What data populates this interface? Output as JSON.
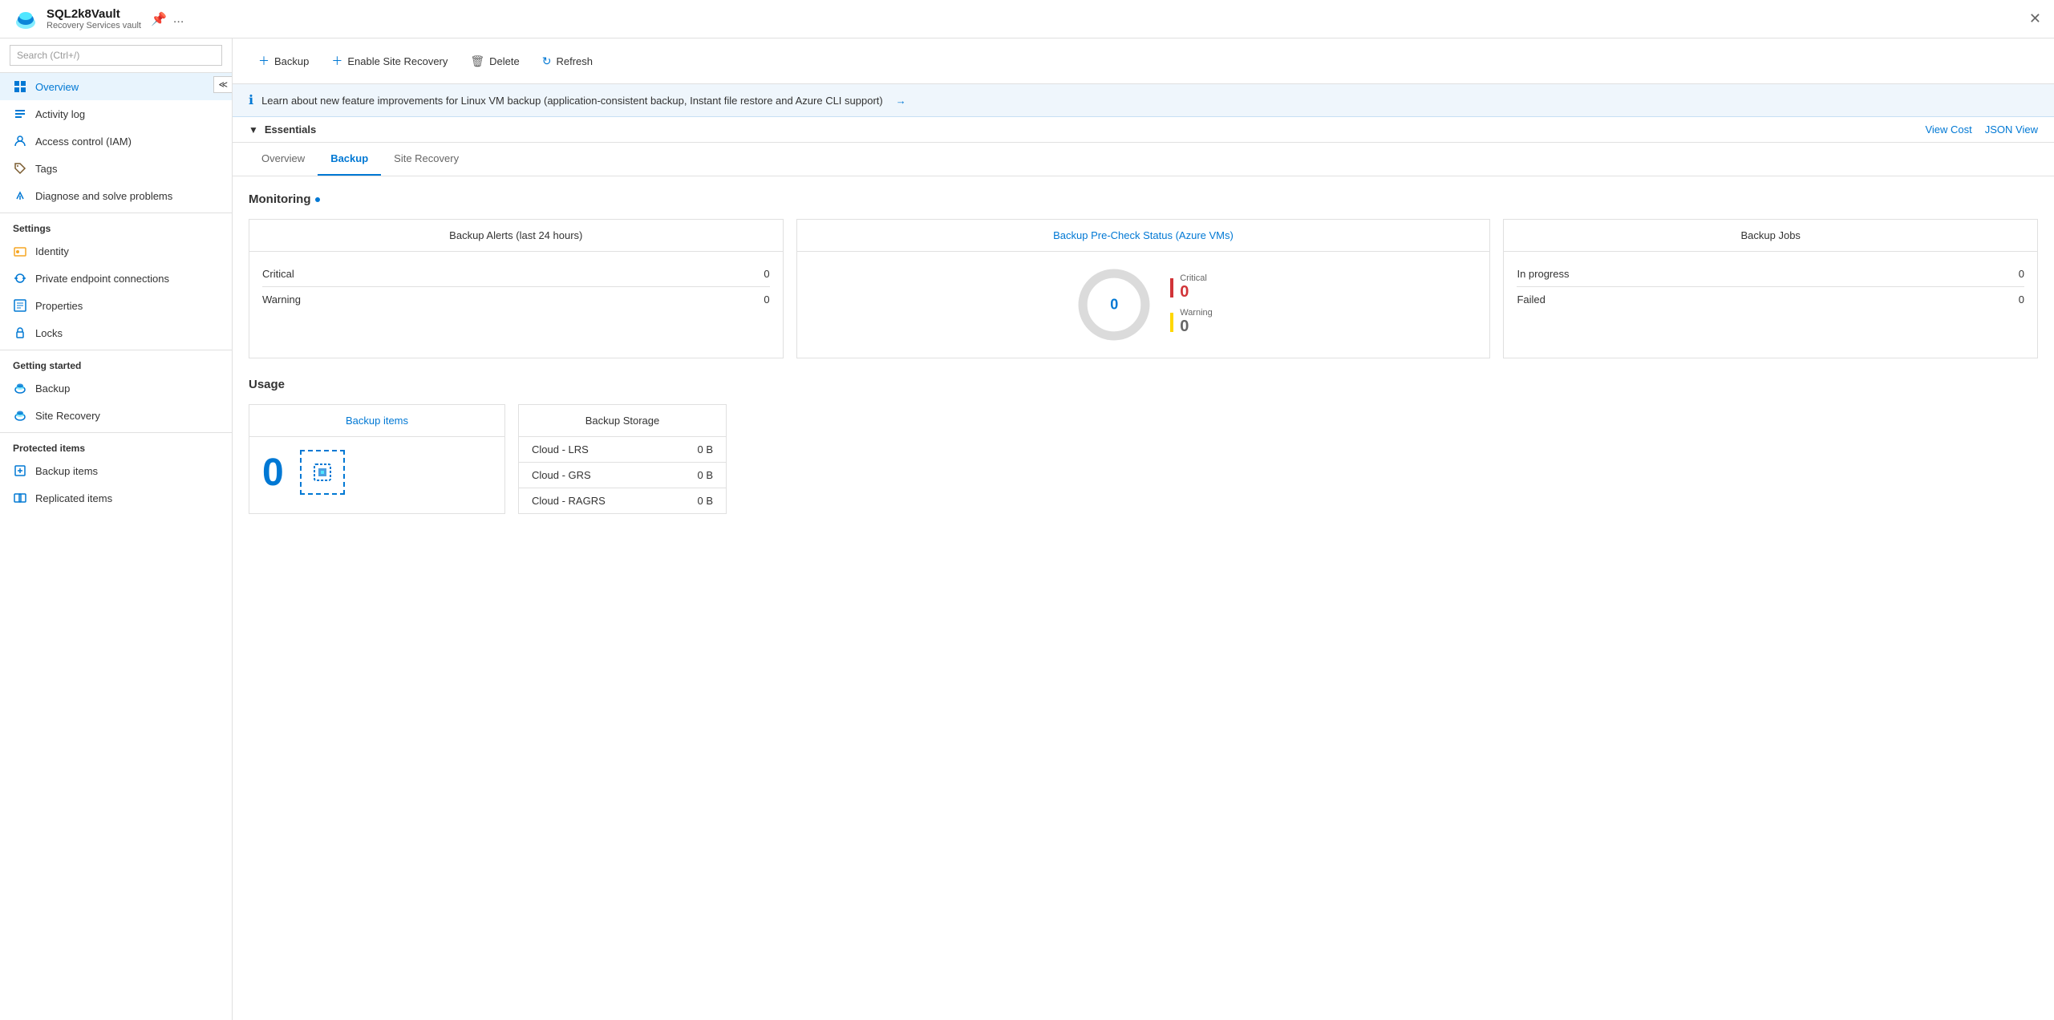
{
  "topbar": {
    "title": "SQL2k8Vault",
    "subtitle": "Recovery Services vault",
    "pin_label": "📌",
    "more_label": "...",
    "close_label": "✕"
  },
  "sidebar": {
    "search_placeholder": "Search (Ctrl+/)",
    "collapse_label": "≪",
    "nav_items": [
      {
        "id": "overview",
        "label": "Overview",
        "icon": "overview",
        "active": true
      },
      {
        "id": "activity-log",
        "label": "Activity log",
        "icon": "activity"
      },
      {
        "id": "access-control",
        "label": "Access control (IAM)",
        "icon": "access"
      },
      {
        "id": "tags",
        "label": "Tags",
        "icon": "tags"
      },
      {
        "id": "diagnose",
        "label": "Diagnose and solve problems",
        "icon": "diagnose"
      }
    ],
    "sections": [
      {
        "header": "Settings",
        "items": [
          {
            "id": "identity",
            "label": "Identity",
            "icon": "identity"
          },
          {
            "id": "private-endpoint",
            "label": "Private endpoint connections",
            "icon": "endpoint"
          },
          {
            "id": "properties",
            "label": "Properties",
            "icon": "properties"
          },
          {
            "id": "locks",
            "label": "Locks",
            "icon": "locks"
          }
        ]
      },
      {
        "header": "Getting started",
        "items": [
          {
            "id": "backup",
            "label": "Backup",
            "icon": "backup"
          },
          {
            "id": "site-recovery",
            "label": "Site Recovery",
            "icon": "siterecovery"
          }
        ]
      },
      {
        "header": "Protected items",
        "items": [
          {
            "id": "backup-items",
            "label": "Backup items",
            "icon": "backupitems"
          },
          {
            "id": "replicated-items",
            "label": "Replicated items",
            "icon": "replicated"
          }
        ]
      }
    ]
  },
  "toolbar": {
    "backup_label": "Backup",
    "enable_site_recovery_label": "Enable Site Recovery",
    "delete_label": "Delete",
    "refresh_label": "Refresh"
  },
  "info_banner": {
    "text": "Learn about new feature improvements for Linux VM backup (application-consistent backup, Instant file restore and Azure CLI support)",
    "arrow": "→"
  },
  "essentials": {
    "label": "Essentials",
    "view_cost": "View Cost",
    "json_view": "JSON View"
  },
  "tabs": [
    {
      "id": "overview-tab",
      "label": "Overview",
      "active": false
    },
    {
      "id": "backup-tab",
      "label": "Backup",
      "active": true
    },
    {
      "id": "site-recovery-tab",
      "label": "Site Recovery",
      "active": false
    }
  ],
  "monitoring": {
    "section_title": "Monitoring",
    "alerts_card": {
      "title": "Backup Alerts (last 24 hours)",
      "rows": [
        {
          "label": "Critical",
          "value": "0"
        },
        {
          "label": "Warning",
          "value": "0"
        }
      ]
    },
    "precheck_card": {
      "title": "Backup Pre-Check Status (Azure VMs)",
      "center_value": "0",
      "legend": [
        {
          "label": "Critical",
          "value": "0",
          "color": "#d13438"
        },
        {
          "label": "Warning",
          "value": "0",
          "color": "#ffd700"
        }
      ]
    },
    "jobs_card": {
      "title": "Backup Jobs",
      "rows": [
        {
          "label": "In progress",
          "value": "0"
        },
        {
          "label": "Failed",
          "value": "0"
        }
      ]
    }
  },
  "usage": {
    "section_title": "Usage",
    "backup_items_card": {
      "title": "Backup items",
      "value": "0"
    },
    "storage_card": {
      "title": "Backup Storage",
      "rows": [
        {
          "label": "Cloud - LRS",
          "value": "0 B"
        },
        {
          "label": "Cloud - GRS",
          "value": "0 B"
        },
        {
          "label": "Cloud - RAGRS",
          "value": "0 B"
        }
      ]
    }
  }
}
